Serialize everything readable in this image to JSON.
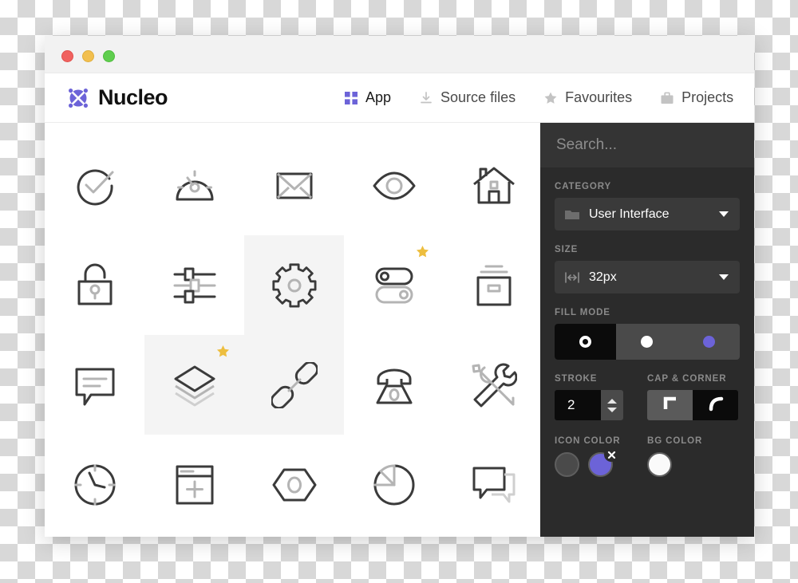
{
  "window": {
    "traffic_lights": [
      "close",
      "minimize",
      "zoom"
    ],
    "brand_name": "Nucleo",
    "logo_icon": "nucleo-atom-logo",
    "accent_color": "#6c63d8"
  },
  "nav": {
    "items": [
      {
        "label": "App",
        "icon": "grid-squares-icon",
        "active": true
      },
      {
        "label": "Source files",
        "icon": "download-icon",
        "active": false
      },
      {
        "label": "Favourites",
        "icon": "star-icon",
        "active": false
      },
      {
        "label": "Projects",
        "icon": "briefcase-icon",
        "active": false
      }
    ]
  },
  "grid": {
    "columns": 5,
    "rows": 4,
    "icons": [
      {
        "name": "check-circle-icon",
        "selected": false,
        "favourite": false
      },
      {
        "name": "gauge-icon",
        "selected": false,
        "favourite": false
      },
      {
        "name": "envelope-icon",
        "selected": false,
        "favourite": false
      },
      {
        "name": "eye-icon",
        "selected": false,
        "favourite": false
      },
      {
        "name": "home-icon",
        "selected": false,
        "favourite": false
      },
      {
        "name": "unlock-icon",
        "selected": false,
        "favourite": false
      },
      {
        "name": "sliders-icon",
        "selected": false,
        "favourite": false
      },
      {
        "name": "gear-icon",
        "selected": true,
        "favourite": false
      },
      {
        "name": "toggles-icon",
        "selected": false,
        "favourite": true
      },
      {
        "name": "archive-box-icon",
        "selected": false,
        "favourite": false
      },
      {
        "name": "chat-bubble-icon",
        "selected": false,
        "favourite": false
      },
      {
        "name": "layers-icon",
        "selected": true,
        "favourite": true
      },
      {
        "name": "link-chain-icon",
        "selected": true,
        "favourite": false
      },
      {
        "name": "telephone-icon",
        "selected": false,
        "favourite": false
      },
      {
        "name": "tools-icon",
        "selected": false,
        "favourite": false
      },
      {
        "name": "clock-icon",
        "selected": false,
        "favourite": false
      },
      {
        "name": "new-window-icon",
        "selected": false,
        "favourite": false
      },
      {
        "name": "hex-nut-icon",
        "selected": false,
        "favourite": false
      },
      {
        "name": "pie-chart-icon",
        "selected": false,
        "favourite": false
      },
      {
        "name": "chat-bubbles-icon",
        "selected": false,
        "favourite": false
      }
    ]
  },
  "sidebar": {
    "search": {
      "placeholder": "Search...",
      "value": ""
    },
    "category": {
      "label": "CATEGORY",
      "value": "User Interface",
      "icon": "folder-icon"
    },
    "size": {
      "label": "SIZE",
      "value": "32px",
      "icon": "resize-horizontal-icon"
    },
    "fill_mode": {
      "label": "FILL MODE",
      "options": [
        {
          "name": "outline",
          "selected": true
        },
        {
          "name": "solid-white",
          "selected": false
        },
        {
          "name": "solid-color",
          "selected": false
        }
      ]
    },
    "stroke": {
      "label": "STROKE",
      "value": "2"
    },
    "cap_corner": {
      "label": "CAP & CORNER",
      "options": [
        {
          "name": "square-corner",
          "selected": true
        },
        {
          "name": "rounded-corner",
          "selected": false
        }
      ]
    },
    "icon_color": {
      "label": "ICON COLOR",
      "swatches": [
        {
          "name": "gray",
          "hex": "#4a4a4a",
          "selected": false
        },
        {
          "name": "purple",
          "hex": "#6c63d8",
          "selected": true
        }
      ]
    },
    "bg_color": {
      "label": "BG COLOR",
      "swatches": [
        {
          "name": "white",
          "hex": "#fafafa",
          "selected": true
        }
      ]
    }
  }
}
